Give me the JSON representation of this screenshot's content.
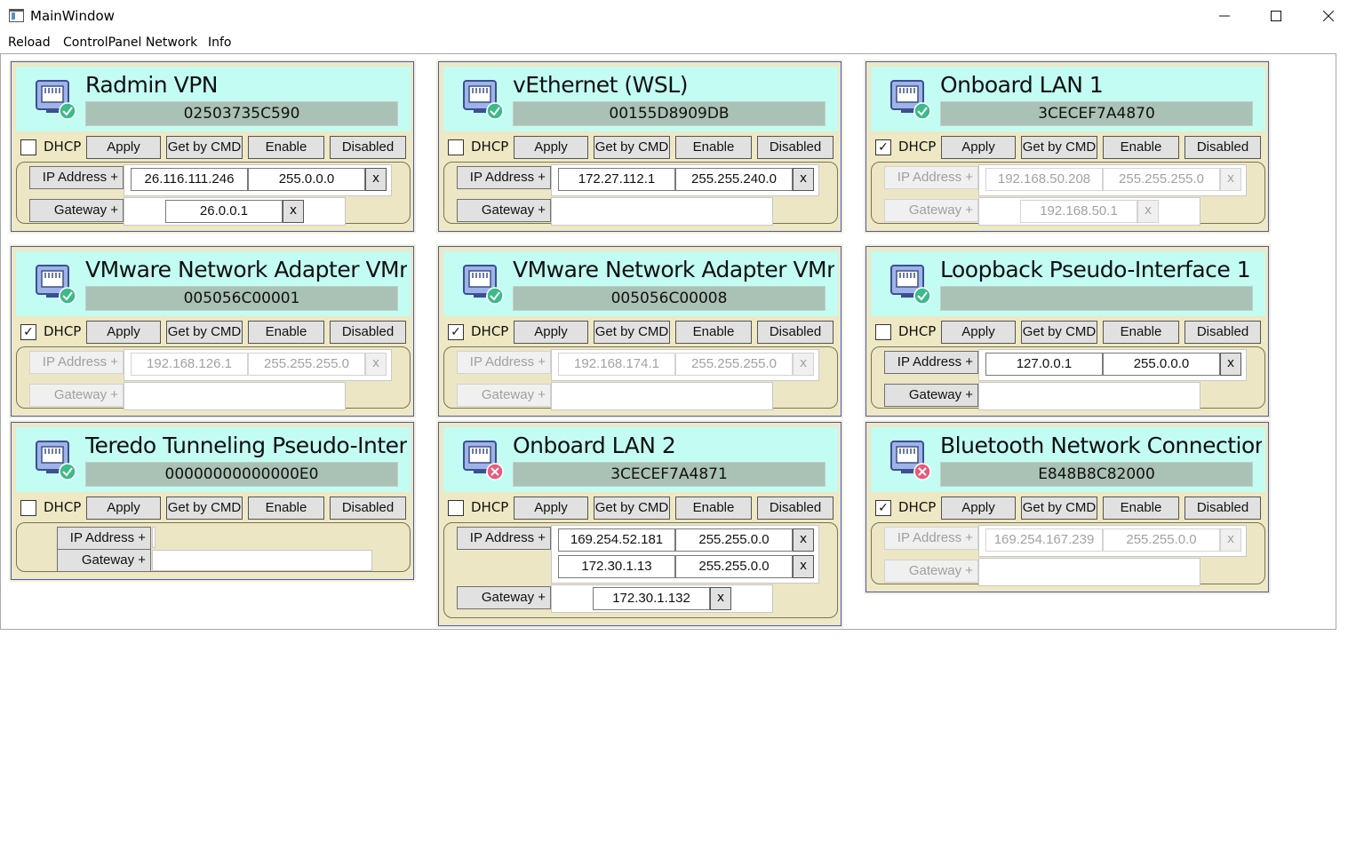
{
  "window": {
    "title": "MainWindow",
    "minimize": "—",
    "maximize": "☐",
    "close": "✕"
  },
  "menu": [
    "Reload",
    "ControlPanel Network",
    "Info"
  ],
  "labels": {
    "dhcp": "DHCP",
    "apply": "Apply",
    "get_by_cmd": "Get by CMD",
    "enable": "Enable",
    "disabled": "Disabled",
    "ip_address": "IP Address +",
    "gateway": "Gateway +",
    "remove": "x"
  },
  "colors": {
    "header_bg": "#c3fcf3",
    "card_bg": "#eee8c4",
    "mac_bg": "#aac1b5",
    "status_ok": "#3cba8a",
    "status_err": "#e85a7a"
  },
  "adapters": [
    {
      "name": "Radmin VPN",
      "mac": "02503735C590",
      "status": "ok",
      "dhcp": false,
      "ips": [
        {
          "ip": "26.116.111.246",
          "mask": "255.0.0.0"
        }
      ],
      "gateways": [
        "26.0.0.1"
      ]
    },
    {
      "name": "vEthernet (WSL)",
      "mac": "00155D8909DB",
      "status": "ok",
      "dhcp": false,
      "ips": [
        {
          "ip": "172.27.112.1",
          "mask": "255.255.240.0"
        }
      ],
      "gateways": []
    },
    {
      "name": "Onboard LAN 1",
      "mac": "3CECEF7A4870",
      "status": "ok",
      "dhcp": true,
      "ips": [
        {
          "ip": "192.168.50.208",
          "mask": "255.255.255.0"
        }
      ],
      "gateways": [
        "192.168.50.1"
      ]
    },
    {
      "name": "VMware Network Adapter VMne",
      "mac": "005056C00001",
      "status": "ok",
      "dhcp": true,
      "ips": [
        {
          "ip": "192.168.126.1",
          "mask": "255.255.255.0"
        }
      ],
      "gateways": []
    },
    {
      "name": "VMware Network Adapter VMne",
      "mac": "005056C00008",
      "status": "ok",
      "dhcp": true,
      "ips": [
        {
          "ip": "192.168.174.1",
          "mask": "255.255.255.0"
        }
      ],
      "gateways": []
    },
    {
      "name": "Loopback Pseudo-Interface 1",
      "mac": "",
      "status": "ok",
      "dhcp": false,
      "ips": [
        {
          "ip": "127.0.0.1",
          "mask": "255.0.0.0"
        }
      ],
      "gateways": []
    },
    {
      "name": "Teredo Tunneling Pseudo-Interfa",
      "mac": "00000000000000E0",
      "status": "ok",
      "dhcp": false,
      "ips": [],
      "gateways": []
    },
    {
      "name": "Onboard LAN 2",
      "mac": "3CECEF7A4871",
      "status": "error",
      "dhcp": false,
      "ips": [
        {
          "ip": "169.254.52.181",
          "mask": "255.255.0.0"
        },
        {
          "ip": "172.30.1.13",
          "mask": "255.255.0.0"
        }
      ],
      "gateways": [
        "172.30.1.132"
      ]
    },
    {
      "name": "Bluetooth Network Connection",
      "mac": "E848B8C82000",
      "status": "error",
      "dhcp": true,
      "ips": [
        {
          "ip": "169.254.167.239",
          "mask": "255.255.0.0"
        }
      ],
      "gateways": []
    }
  ]
}
